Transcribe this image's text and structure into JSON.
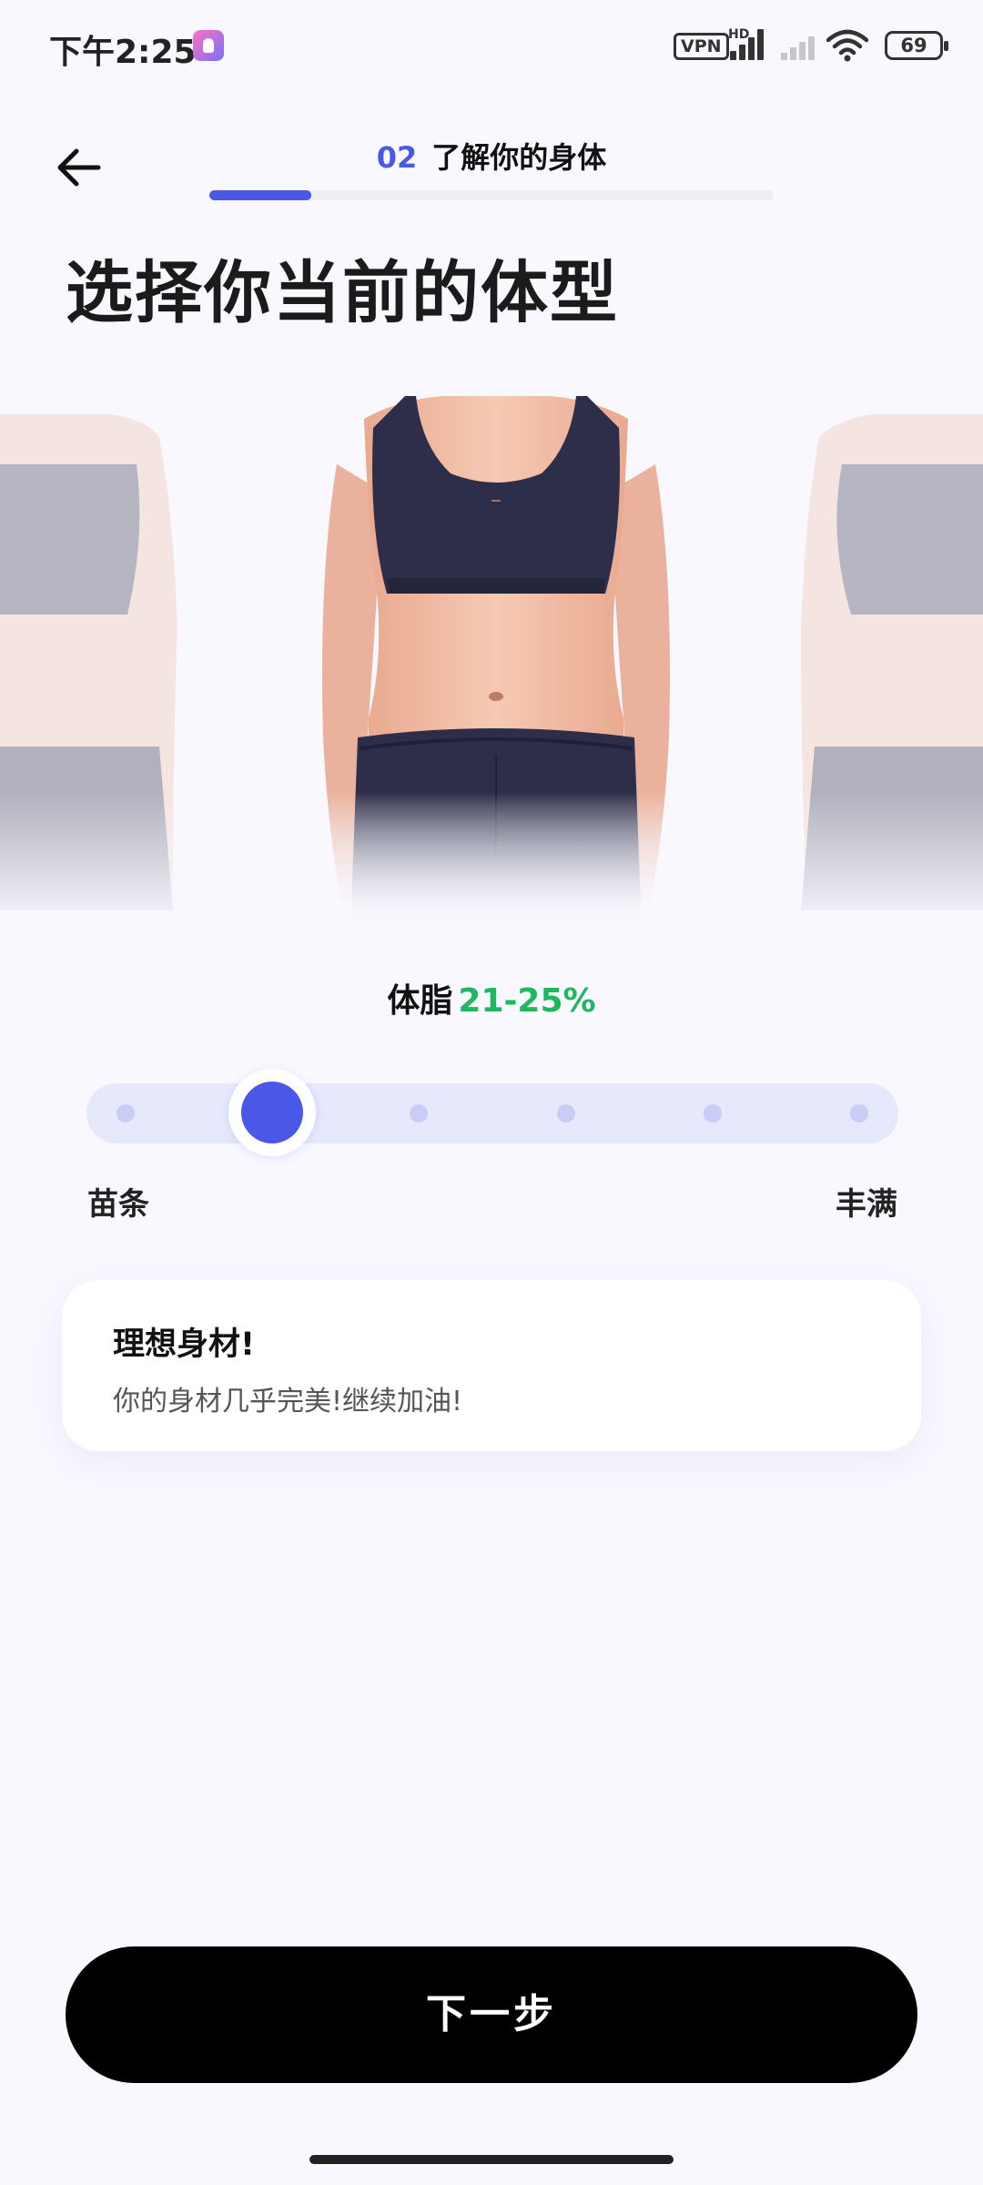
{
  "status_bar": {
    "time": "下午2:25",
    "vpn": "VPN",
    "network": "HD",
    "battery": "69"
  },
  "header": {
    "step_number": "02",
    "step_title": "了解你的身体",
    "progress": 0.18
  },
  "page_title": "选择你当前的体型",
  "body_fat": {
    "label": "体脂",
    "value": "21-25%"
  },
  "slider": {
    "positions": 6,
    "selected_index": 1,
    "min_label": "苗条",
    "max_label": "丰满"
  },
  "info_card": {
    "title": "理想身材!",
    "text": "你的身材几乎完美!继续加油!"
  },
  "next_button": {
    "label": "下一步"
  },
  "colors": {
    "accent": "#4b57e6",
    "highlight": "#1fb85f",
    "background": "#f8f8fe"
  }
}
